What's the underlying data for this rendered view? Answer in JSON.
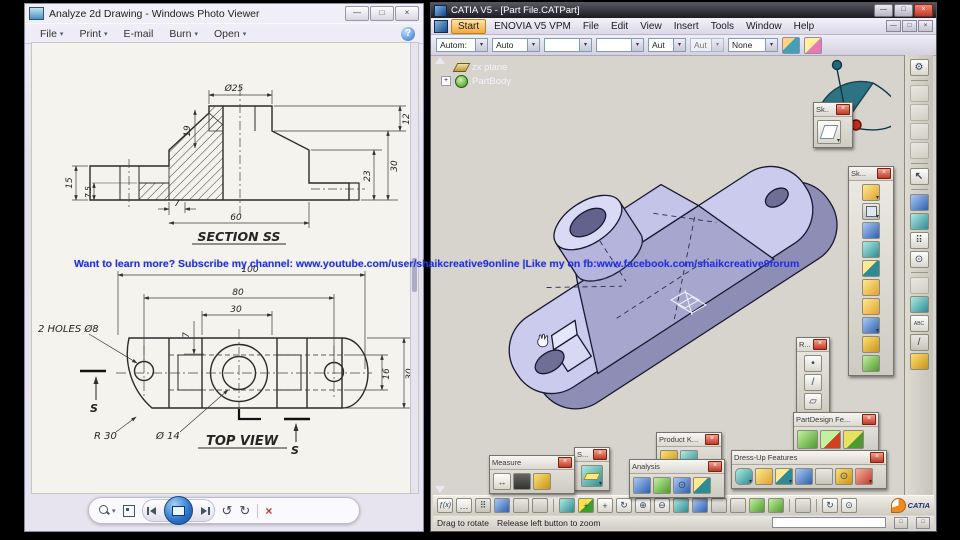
{
  "watermark": "Want to learn more? Subscribe my channel: www.youtube.com/user/shaikcreative9online |Like my on fb:www.facebook.com/shaikcreative9forum",
  "glyphs": {
    "min": "—",
    "max": "□",
    "close": "×",
    "caret": "▾",
    "help": "?",
    "rot_ccw": "↺",
    "rot_cw": "↻",
    "delete": "×",
    "expander": "+",
    "cursor": "↖",
    "gear": "⚙",
    "grid": "⠿",
    "target": "⊙",
    "zoom_in": "⊕",
    "zoom_out": "⊖",
    "pan": "+",
    "rotate": "↻",
    "fx": "ƒ(x)",
    "chat": "…",
    "abc": "ABC",
    "dot": "•",
    "slash": "/",
    "plane": "▱"
  },
  "photo_viewer": {
    "title": "Analyze 2d Drawing - Windows Photo Viewer",
    "menu": {
      "file": "File",
      "print": "Print",
      "email": "E-mail",
      "burn": "Burn",
      "open": "Open"
    },
    "drawing": {
      "section": {
        "label": "SECTION SS",
        "dia25": "Ø25",
        "d19": "19",
        "d12": "12",
        "d30": "30",
        "d23": "23",
        "d15": "15",
        "d7_5": "7.5",
        "d7": "7",
        "d60": "60"
      },
      "top": {
        "label": "TOP VIEW",
        "holes": "2 HOLES Ø8",
        "d100": "100",
        "d80": "80",
        "d30a": "30",
        "d7": "7",
        "d16": "16",
        "d30b": "30",
        "r30": "R 30",
        "dia14": "Ø 14",
        "s1": "S",
        "s2": "S"
      }
    }
  },
  "catia": {
    "title": "CATIA V5 - [Part File.CATPart]",
    "menu": {
      "start": "Start",
      "enovia": "ENOVIA V5 VPM",
      "file": "File",
      "edit": "Edit",
      "view": "View",
      "insert": "Insert",
      "tools": "Tools",
      "window": "Window",
      "help": "Help"
    },
    "props": {
      "fill": "Autom:",
      "color": "Auto",
      "aut1": "Aut",
      "aut2": "Aut",
      "none": "None"
    },
    "tree": {
      "item1": "zx plane",
      "item2": "PartBody"
    },
    "toolbars": {
      "sketcher": "Sk..",
      "sketch_features": "Sk...",
      "reference": "R...",
      "partdesign": "PartDesign Fe...",
      "dressup": "Dress-Up Features",
      "productk": "Product K...",
      "analysis": "Analysis",
      "measure": "Measure",
      "surface": "S..."
    },
    "status": {
      "msg1": "Drag to rotate",
      "msg2": "Release left button to zoom"
    },
    "logo": "CATIA"
  }
}
